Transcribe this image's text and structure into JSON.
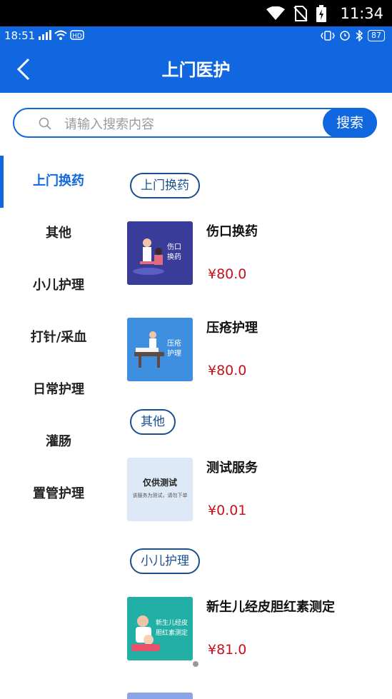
{
  "system_status": {
    "time": "11:34"
  },
  "phone_status": {
    "time": "18:51",
    "signal": "4G",
    "battery": "87"
  },
  "header": {
    "title": "上门医护"
  },
  "search": {
    "placeholder": "请输入搜索内容",
    "value": "",
    "button_label": "搜索"
  },
  "categories": [
    {
      "label": "上门换药",
      "active": true
    },
    {
      "label": "其他",
      "active": false
    },
    {
      "label": "小儿护理",
      "active": false
    },
    {
      "label": "打针/采血",
      "active": false
    },
    {
      "label": "日常护理",
      "active": false
    },
    {
      "label": "灌肠",
      "active": false
    },
    {
      "label": "置管护理",
      "active": false
    }
  ],
  "sections": [
    {
      "title": "上门换药",
      "items": [
        {
          "name": "伤口换药",
          "price": "¥80.0",
          "image_text": [
            "伤口",
            "换药"
          ],
          "image_color": "#3d3f9e"
        },
        {
          "name": "压疮护理",
          "price": "¥80.0",
          "image_text": [
            "压疮",
            "护理"
          ],
          "image_color": "#3f8fe0"
        }
      ]
    },
    {
      "title": "其他",
      "items": [
        {
          "name": "测试服务",
          "price": "¥0.01",
          "image_text": [
            "仅供测试",
            "该服务为测试，请勿下单"
          ],
          "image_color": "#dde9f6"
        }
      ]
    },
    {
      "title": "小儿护理",
      "items": [
        {
          "name": "新生儿经皮胆红素测定",
          "price": "¥81.0",
          "image_text": [
            "新生儿经皮",
            "胆红素测定"
          ],
          "image_color": "#22b0a6"
        }
      ]
    }
  ],
  "colors": {
    "primary": "#1067e0",
    "price": "#c6111c",
    "pill_border": "#1a4f8f"
  }
}
